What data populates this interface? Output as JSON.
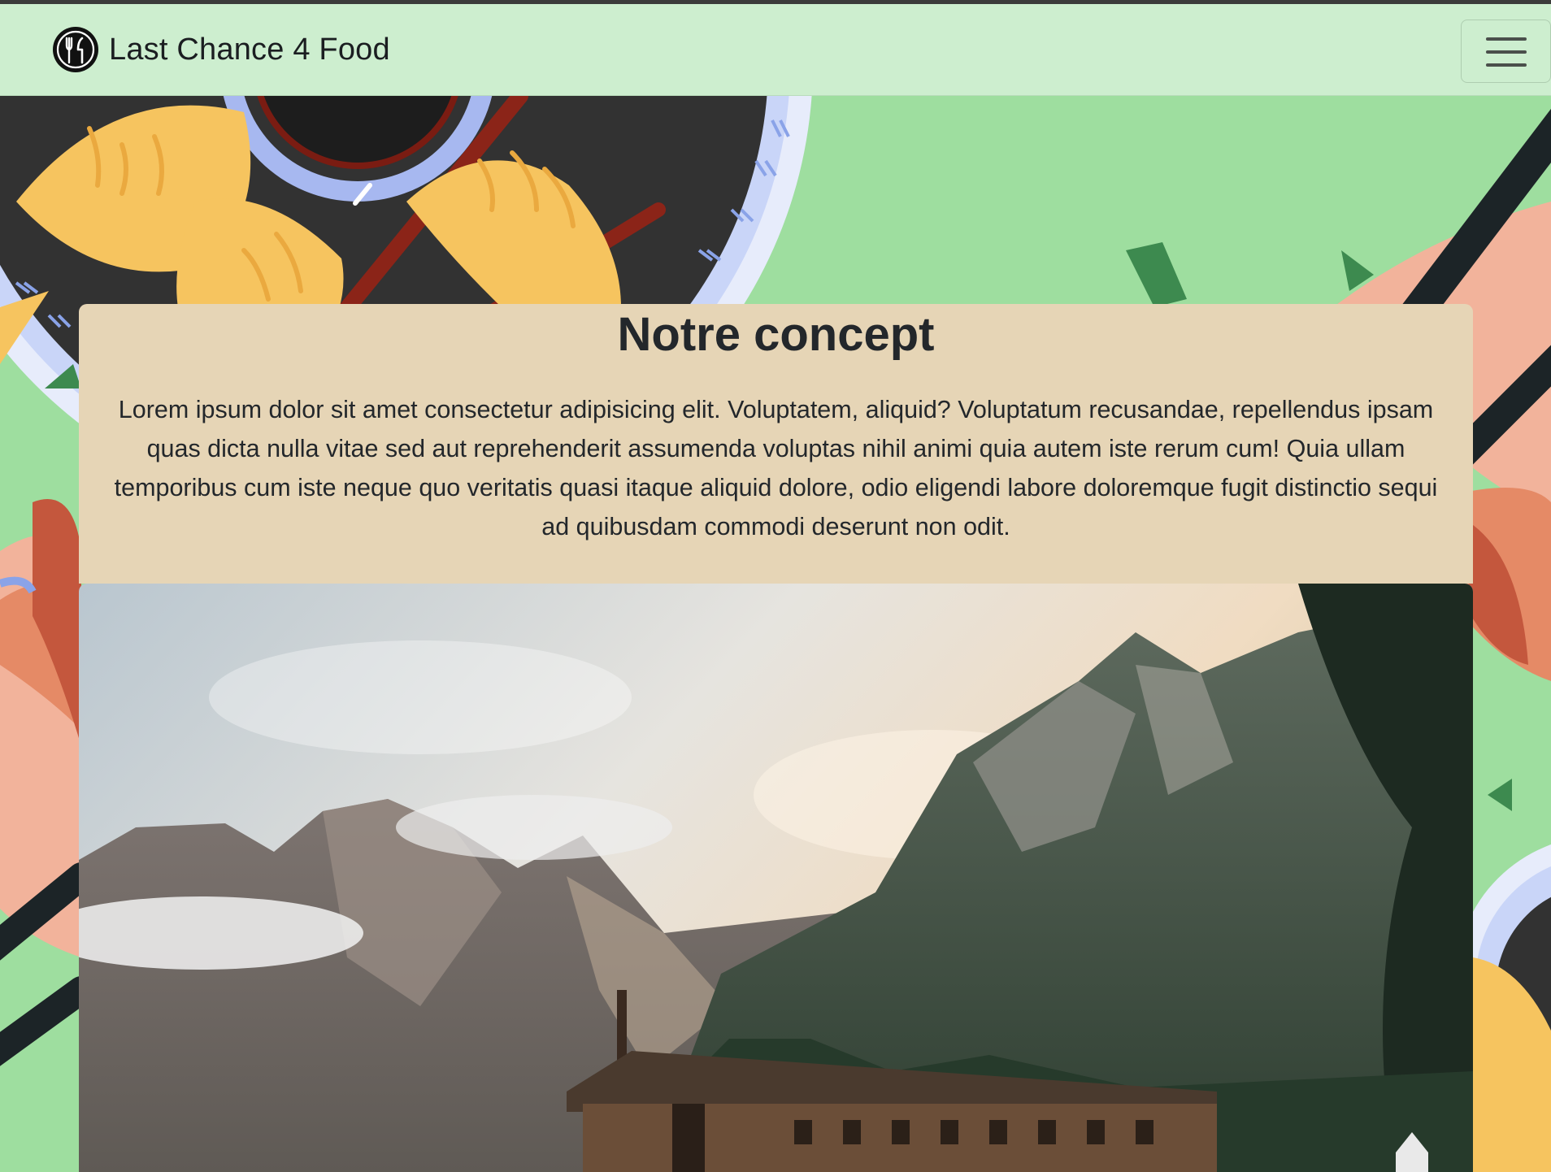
{
  "navbar": {
    "brand_name": "Last Chance 4 Food",
    "logo_icon": "fork-and-knife-icon",
    "menu_icon": "hamburger-menu-icon"
  },
  "concept": {
    "title": "Notre concept",
    "text": "Lorem ipsum dolor sit amet consectetur adipisicing elit. Voluptatem, aliquid? Voluptatum recusandae, repellendus ipsam quas dicta nulla vitae sed aut reprehenderit assumenda voluptas nihil animi quia autem iste rerum cum! Quia ullam temporibus cum iste neque quo veritatis quasi itaque aliquid dolore, odio eligendi labore doloremque fugit distinctio sequi ad quibusdam commodi deserunt non odit."
  },
  "colors": {
    "navbar_bg": "#cdeecf",
    "page_bg": "#9ede9f",
    "card_bg": "#e6d5b6",
    "plate": "#333333",
    "dumpling": "#f6c45f"
  }
}
